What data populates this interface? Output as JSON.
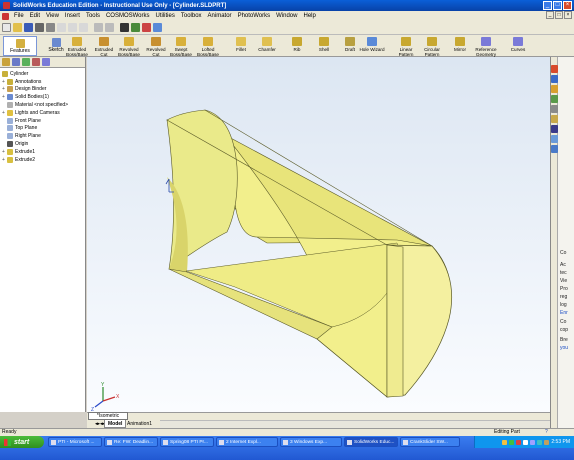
{
  "window": {
    "title": "SolidWorks Education Edition - Instructional Use Only - [Cylinder.SLDPRT]",
    "min": "_",
    "max": "□",
    "close": "×"
  },
  "menu": [
    "File",
    "Edit",
    "View",
    "Insert",
    "Tools",
    "COSMOSWorks",
    "Utilities",
    "Toolbox",
    "Animator",
    "PhotoWorks",
    "Window",
    "Help"
  ],
  "commands": {
    "features": "Features",
    "sketch": "Sketch",
    "items": [
      "Extruded\nBoss/Base",
      "Extruded\nCut",
      "Revolved\nBoss/Base",
      "Revolved\nCut",
      "Swept\nBoss/Base",
      "Lofted\nBoss/Base",
      "Fillet",
      "Chamfer",
      "Rib",
      "Shell",
      "Draft",
      "Hole Wizard",
      "Linear\nPattern",
      "Circular\nPattern",
      "Mirror",
      "Reference\nGeometry",
      "Curves"
    ]
  },
  "tree": {
    "root": "Cylinder",
    "items": [
      {
        "label": "Annotations",
        "expand": "+",
        "icon": "annotations-icon"
      },
      {
        "label": "Design Binder",
        "expand": "+",
        "icon": "design-binder-icon"
      },
      {
        "label": "Solid Bodies(1)",
        "expand": "+",
        "icon": "solid-bodies-icon"
      },
      {
        "label": "Material <not specified>",
        "expand": "",
        "icon": "material-icon"
      },
      {
        "label": "Lights and Cameras",
        "expand": "+",
        "icon": "lights-icon"
      },
      {
        "label": "Front Plane",
        "expand": "",
        "icon": "plane-icon"
      },
      {
        "label": "Top Plane",
        "expand": "",
        "icon": "plane-icon"
      },
      {
        "label": "Right Plane",
        "expand": "",
        "icon": "plane-icon"
      },
      {
        "label": "Origin",
        "expand": "",
        "icon": "origin-icon"
      },
      {
        "label": "Extrude1",
        "expand": "+",
        "icon": "extrude-icon"
      },
      {
        "label": "Extrude2",
        "expand": "+",
        "icon": "extrude-icon"
      }
    ]
  },
  "viewport": {
    "view_label": "*Isometric",
    "tabs": [
      "Model",
      "Animation1"
    ],
    "axes": {
      "x": "X",
      "y": "Y",
      "z": "Z"
    }
  },
  "status": {
    "left": "Ready",
    "right": "Editing Part"
  },
  "right_pane": {
    "snippets": [
      "Co",
      "Ac",
      "tec",
      "Vie",
      "Pro",
      "reg",
      "log",
      "Enr",
      "Co",
      "cop",
      "Bre",
      "you"
    ]
  },
  "taskbar": {
    "start": "start",
    "tasks": [
      "PTI - Microsoft ...",
      "Re: FW: Deadlin...",
      "Spring08 PTI Pr...",
      "2 Internet Expl...",
      "3 Windows Exp...",
      "SolidWorks Educ...",
      "CrankSlider SW..."
    ],
    "clock": "2:53 PM"
  },
  "colors": {
    "part_fill": "#f0f08c",
    "part_edge": "#5a5a28",
    "selection": "#316ac5"
  }
}
